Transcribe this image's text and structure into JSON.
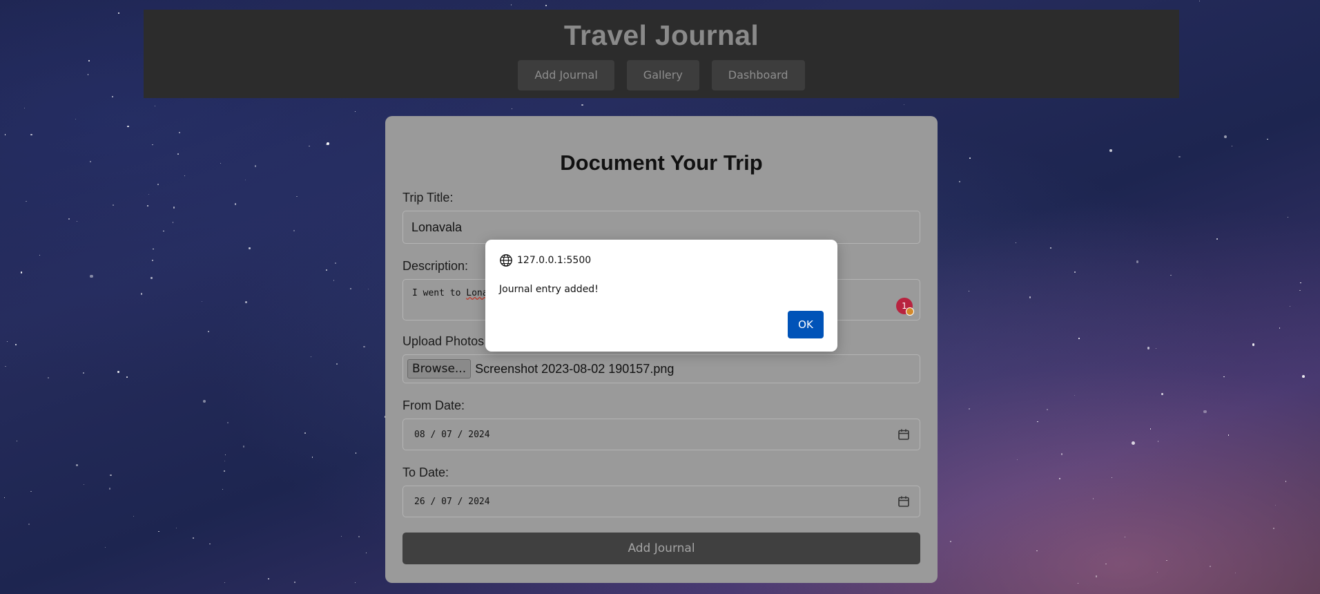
{
  "header": {
    "title": "Travel Journal",
    "nav": [
      "Add Journal",
      "Gallery",
      "Dashboard"
    ]
  },
  "form": {
    "heading": "Document Your Trip",
    "trip_title": {
      "label": "Trip Title:",
      "value": "Lonavala"
    },
    "description": {
      "label": "Description:",
      "value_prefix": "I went to ",
      "value_misspelled": "Lona",
      "badge": "1"
    },
    "photos": {
      "label": "Upload Photos",
      "browse_label": "Browse...",
      "file_name": "Screenshot 2023-08-02 190157.png"
    },
    "from_date": {
      "label": "From Date:",
      "value": "08 / 07 / 2024"
    },
    "to_date": {
      "label": "To Date:",
      "value": "26 / 07 / 2024"
    },
    "submit_label": "Add Journal"
  },
  "dialog": {
    "origin": "127.0.0.1:5500",
    "message": "Journal entry added!",
    "ok_label": "OK"
  },
  "colors": {
    "header_bg": "#2c2c2c",
    "card_bg": "#9a9a9a",
    "submit_bg": "#404040",
    "ok_button": "#0053b8",
    "badge": "#b8233f"
  }
}
